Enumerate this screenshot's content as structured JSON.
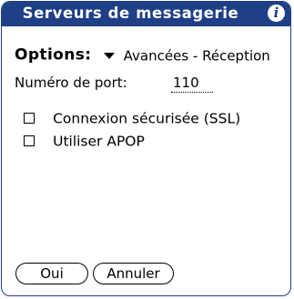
{
  "window": {
    "title": "Serveurs de messagerie",
    "info_icon": "info-icon"
  },
  "options": {
    "label": "Options:",
    "selected": "Avancées - Réception",
    "trigger_icon": "triangle-down-icon"
  },
  "port": {
    "label": "Numéro de port:",
    "value": "110"
  },
  "checkboxes": [
    {
      "label": "Connexion sécurisée (SSL)",
      "checked": false
    },
    {
      "label": "Utiliser APOP",
      "checked": false
    }
  ],
  "buttons": {
    "ok": "Oui",
    "cancel": "Annuler"
  },
  "colors": {
    "titlebar": "#1f3f86",
    "background": "#ffffff",
    "text": "#000000"
  }
}
